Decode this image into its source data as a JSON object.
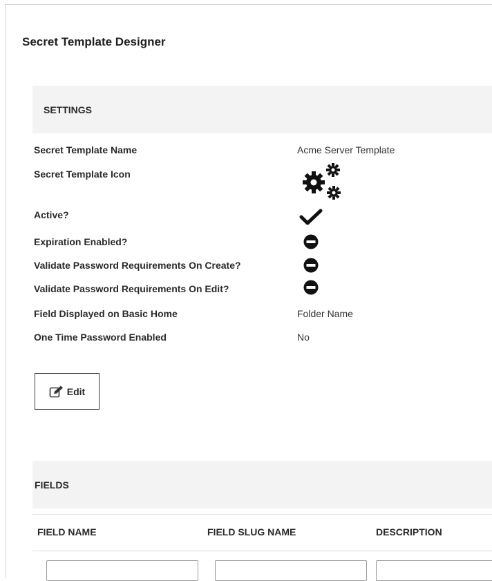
{
  "page": {
    "title": "Secret Template Designer"
  },
  "settings": {
    "header": "SETTINGS",
    "rows": [
      {
        "label": "Secret Template Name",
        "value": "Acme Server Template"
      },
      {
        "label": "Secret Template Icon",
        "icon": "gears-icon"
      },
      {
        "label": "Active?",
        "icon": "checkmark-icon"
      },
      {
        "label": "Expiration Enabled?",
        "icon": "minus-circle-icon"
      },
      {
        "label": "Validate Password Requirements On Create?",
        "icon": "minus-circle-icon"
      },
      {
        "label": "Validate Password Requirements On Edit?",
        "icon": "minus-circle-icon"
      },
      {
        "label": "Field Displayed on Basic Home",
        "value": "Folder Name"
      },
      {
        "label": "One Time Password Enabled",
        "value": "No"
      }
    ],
    "edit_label": "Edit"
  },
  "fields": {
    "header": "FIELDS",
    "columns": [
      "FIELD NAME",
      "FIELD SLUG NAME",
      "DESCRIPTION"
    ]
  },
  "colors": {
    "section_bg": "#f3f3f3",
    "border": "#d4d4d4",
    "text": "#2a2a2a"
  }
}
